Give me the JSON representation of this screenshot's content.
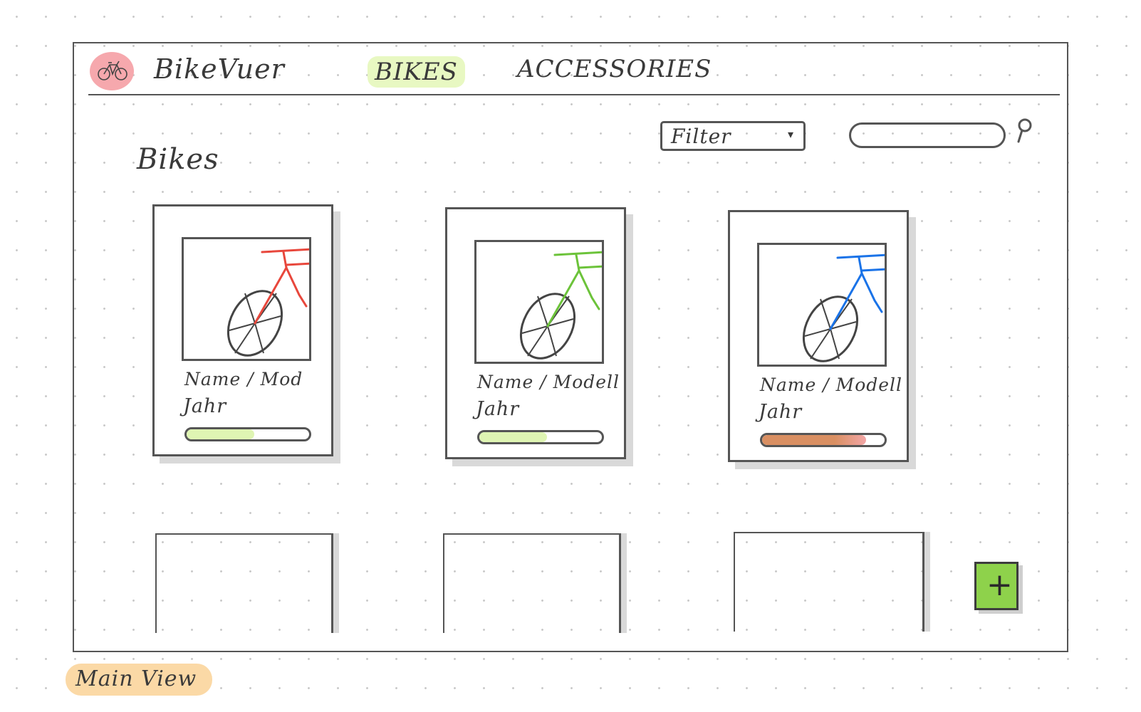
{
  "header": {
    "app_title": "BikeVuer",
    "logo_icon": "bicycle-icon",
    "nav": [
      {
        "label": "BIKES",
        "active": true
      },
      {
        "label": "ACCESSORIES",
        "active": false
      }
    ]
  },
  "toolbar": {
    "filter_label": "Filter",
    "filter_caret": "▾",
    "search_placeholder": "",
    "search_icon": "search-icon"
  },
  "main": {
    "section_title": "Bikes",
    "cards": [
      {
        "name": "Name / Mod",
        "year": "Jahr",
        "bike_color": "#e8473c",
        "bar_level": 0.55,
        "bar_color": "#dff5b3"
      },
      {
        "name": "Name / Modell",
        "year": "Jahr",
        "bike_color": "#6cc33a",
        "bar_level": 0.55,
        "bar_color": "#dff5b3"
      },
      {
        "name": "Name / Modell",
        "year": "Jahr",
        "bike_color": "#1a73e8",
        "bar_level": 0.85,
        "bar_color": "#d98f62",
        "bar_accent": "#f2a6a6"
      }
    ],
    "add_button_label": "+"
  },
  "footer": {
    "view_label": "Main View"
  },
  "colors": {
    "logo": "#f6a8ad",
    "nav_highlight": "#e8f8c2",
    "add_button": "#8ed24b",
    "view_label": "#fbd9a6"
  }
}
